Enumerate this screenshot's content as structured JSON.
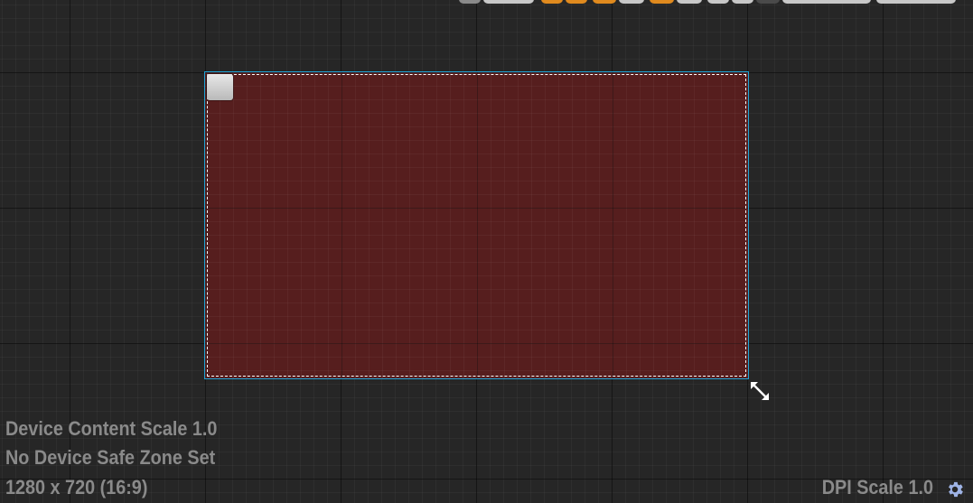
{
  "info": {
    "content_scale": "Device Content Scale 1.0",
    "safe_zone": "No Device Safe Zone Set",
    "resolution": "1280 x 720 (16:9)",
    "dpi_scale": "DPI Scale 1.0"
  },
  "icons": {
    "anchor": "anchor-handle-icon",
    "resize": "resize-diagonal-icon",
    "settings": "gear-icon"
  },
  "colors": {
    "canvas_fill": "#561e1e",
    "selection_border": "#1fa3d6",
    "toolbar_accent": "#e08a1e",
    "info_text": "#8a8a8a"
  }
}
